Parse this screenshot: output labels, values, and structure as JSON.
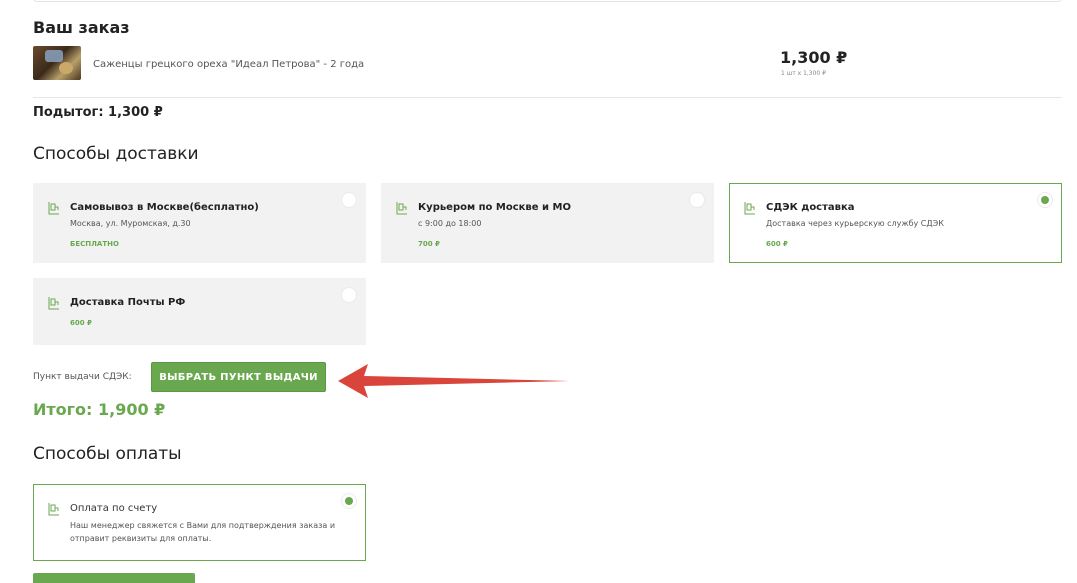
{
  "order": {
    "title": "Ваш заказ",
    "item": {
      "name": "Саженцы грецкого ореха \"Идеал Петрова\" - 2 года",
      "price": "1,300 ₽",
      "qty": "1 шт x 1,300 ₽"
    },
    "subtotal": "Подытог: 1,300 ₽"
  },
  "shipping": {
    "title": "Способы доставки",
    "options": [
      {
        "title": "Самовывоз в Москве(бесплатно)",
        "desc": "Москва, ул. Муромская, д.30",
        "price": "БЕСПЛАТНО",
        "selected": false
      },
      {
        "title": "Курьером по Москве и МО",
        "desc": "с 9:00 до 18:00",
        "price": "700 ₽",
        "selected": false
      },
      {
        "title": "СДЭК доставка",
        "desc": "Доставка через курьерскую службу СДЭК",
        "price": "600 ₽",
        "selected": true
      },
      {
        "title": "Доставка Почты РФ",
        "desc": "",
        "price": "600 ₽",
        "selected": false
      }
    ],
    "pickup_label": "Пункт выдачи СДЭК:",
    "pickup_button": "ВЫБРАТЬ ПУНКТ ВЫДАЧИ"
  },
  "total": "Итого: 1,900 ₽",
  "payment": {
    "title": "Способы оплаты",
    "option": {
      "title": "Оплата по счету",
      "desc": "Наш менеджер свяжется с Вами для подтверждения заказа и отправит реквизиты для оплаты.",
      "selected": true
    }
  },
  "colors": {
    "accent": "#6aa84f",
    "card_bg": "#f2f2f2",
    "annotation_arrow": "#d9453a"
  },
  "icons": {
    "shipping_option": "delivery-box-icon",
    "thumbnail": "product-thumbnail"
  }
}
